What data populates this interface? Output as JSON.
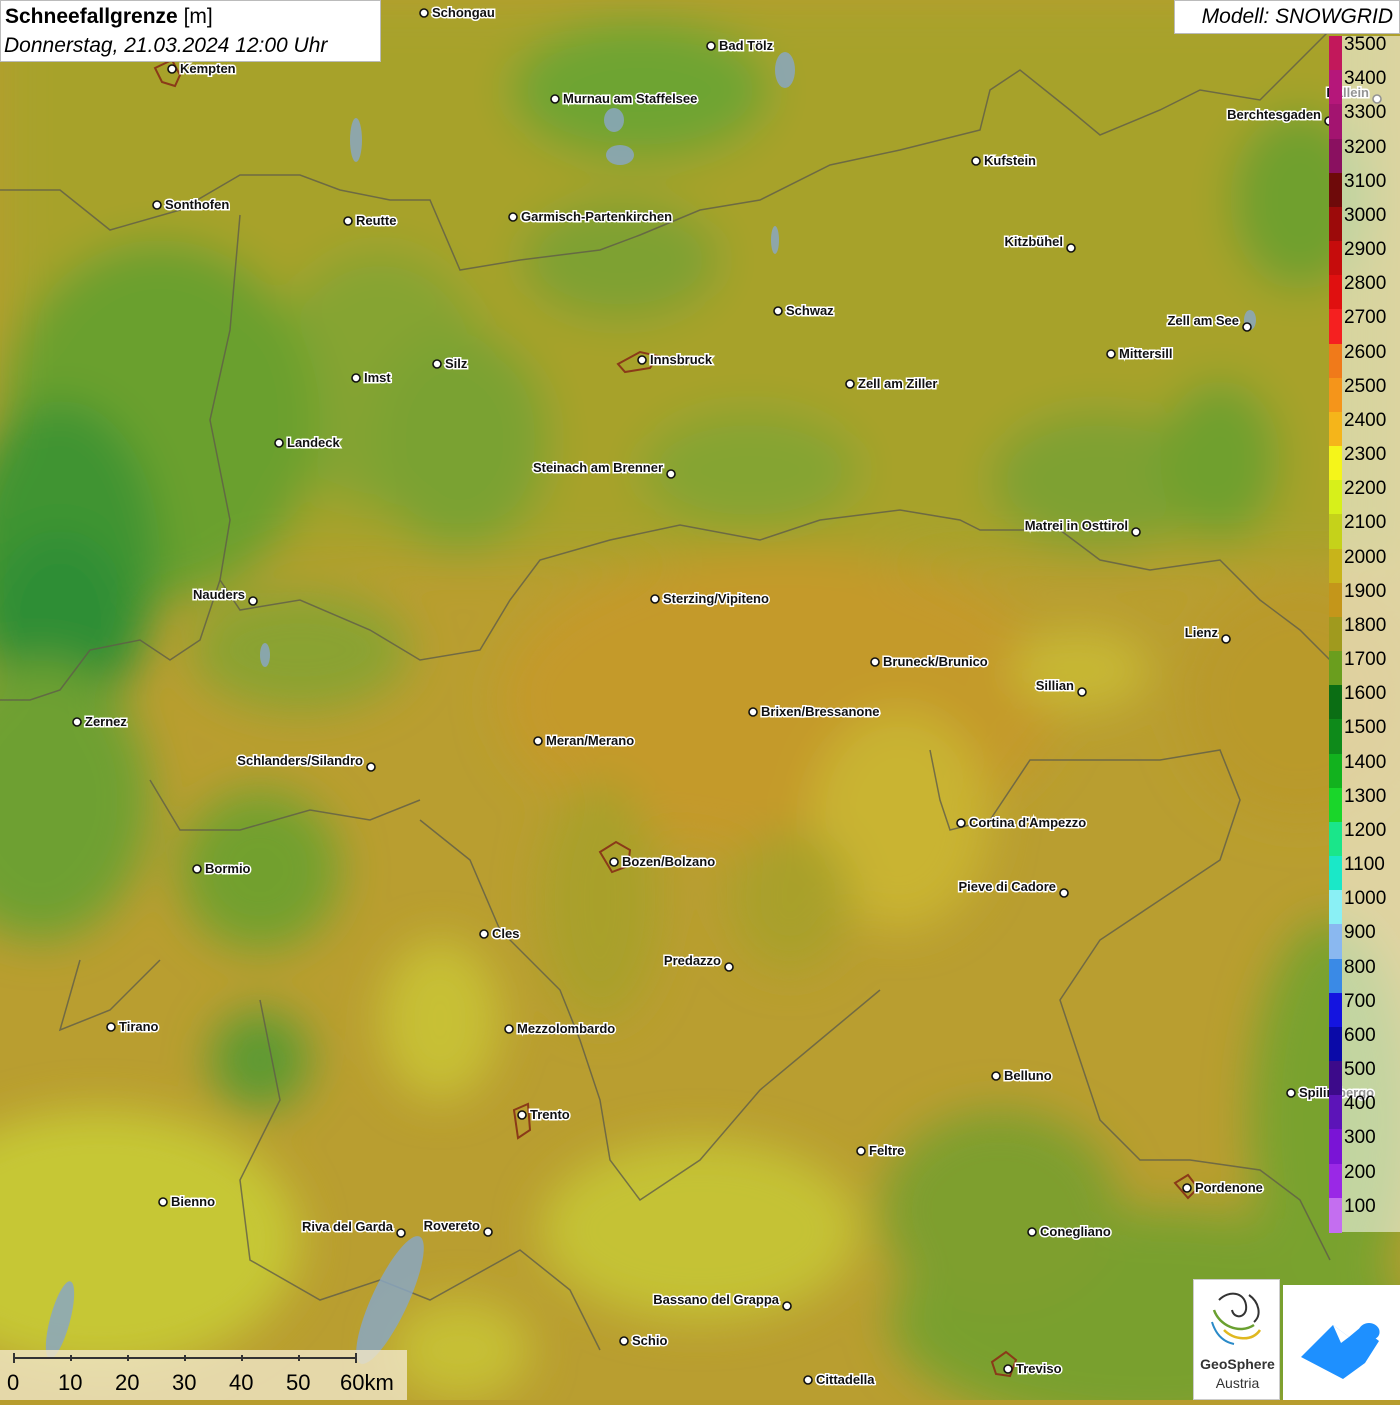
{
  "header": {
    "title": "Schneefallgrenze",
    "unit": "[m]",
    "datetime": "Donnerstag, 21.03.2024 12:00 Uhr"
  },
  "model": {
    "label": "Modell: SNOWGRID"
  },
  "legend": {
    "levels": [
      {
        "label": "3500",
        "color": "#c2185b"
      },
      {
        "label": "3400",
        "color": "#b5177a"
      },
      {
        "label": "3300",
        "color": "#a31470"
      },
      {
        "label": "3200",
        "color": "#8a1060"
      },
      {
        "label": "3100",
        "color": "#6e0a0a"
      },
      {
        "label": "3000",
        "color": "#9c0a0a"
      },
      {
        "label": "2900",
        "color": "#c60c0c"
      },
      {
        "label": "2800",
        "color": "#e01010"
      },
      {
        "label": "2700",
        "color": "#f52020"
      },
      {
        "label": "2600",
        "color": "#f07a1a"
      },
      {
        "label": "2500",
        "color": "#f5951a"
      },
      {
        "label": "2400",
        "color": "#f5b51a"
      },
      {
        "label": "2300",
        "color": "#f5f51a"
      },
      {
        "label": "2200",
        "color": "#d7f01a"
      },
      {
        "label": "2100",
        "color": "#c5d21a"
      },
      {
        "label": "2000",
        "color": "#c8b41a"
      },
      {
        "label": "1900",
        "color": "#c4961a"
      },
      {
        "label": "1800",
        "color": "#a09a1e"
      },
      {
        "label": "1700",
        "color": "#6a9e1e"
      },
      {
        "label": "1600",
        "color": "#0b6e14"
      },
      {
        "label": "1500",
        "color": "#0e8a1a"
      },
      {
        "label": "1400",
        "color": "#12b21e"
      },
      {
        "label": "1300",
        "color": "#1ad62a"
      },
      {
        "label": "1200",
        "color": "#1ae68a"
      },
      {
        "label": "1100",
        "color": "#1ae8c8"
      },
      {
        "label": "1000",
        "color": "#8af0f5"
      },
      {
        "label": "900",
        "color": "#8ab8f0"
      },
      {
        "label": "800",
        "color": "#3a8ae6"
      },
      {
        "label": "700",
        "color": "#1414e0"
      },
      {
        "label": "600",
        "color": "#0a0aa8"
      },
      {
        "label": "500",
        "color": "#3c0a8a"
      },
      {
        "label": "400",
        "color": "#5c14b8"
      },
      {
        "label": "300",
        "color": "#7a14d6"
      },
      {
        "label": "200",
        "color": "#9a28e6"
      },
      {
        "label": "100",
        "color": "#c46ef0"
      }
    ]
  },
  "cities": [
    {
      "name": "Schongau"
    },
    {
      "name": "Bad Tölz"
    },
    {
      "name": "Kempten"
    },
    {
      "name": "Murnau am Staffelsee"
    },
    {
      "name": "Hallein"
    },
    {
      "name": "Berchtesgaden"
    },
    {
      "name": "Kufstein"
    },
    {
      "name": "Sonthofen"
    },
    {
      "name": "Reutte"
    },
    {
      "name": "Garmisch-Partenkirchen"
    },
    {
      "name": "Kitzbühel"
    },
    {
      "name": "Schwaz"
    },
    {
      "name": "Zell am See"
    },
    {
      "name": "Innsbruck"
    },
    {
      "name": "Mittersill"
    },
    {
      "name": "Imst"
    },
    {
      "name": "Silz"
    },
    {
      "name": "Zell am Ziller"
    },
    {
      "name": "Landeck"
    },
    {
      "name": "Steinach am Brenner"
    },
    {
      "name": "Matrei in Osttirol"
    },
    {
      "name": "Nauders"
    },
    {
      "name": "Sterzing/Vipiteno"
    },
    {
      "name": "Lienz"
    },
    {
      "name": "Bruneck/Brunico"
    },
    {
      "name": "Sillian"
    },
    {
      "name": "Brixen/Bressanone"
    },
    {
      "name": "Zernez"
    },
    {
      "name": "Meran/Merano"
    },
    {
      "name": "Schlanders/Silandro"
    },
    {
      "name": "Cortina d'Ampezzo"
    },
    {
      "name": "Bormio"
    },
    {
      "name": "Bozen/Bolzano"
    },
    {
      "name": "Pieve di Cadore"
    },
    {
      "name": "Cles"
    },
    {
      "name": "Predazzo"
    },
    {
      "name": "Tirano"
    },
    {
      "name": "Mezzolombardo"
    },
    {
      "name": "Belluno"
    },
    {
      "name": "Spilimbergo"
    },
    {
      "name": "Trento"
    },
    {
      "name": "Feltre"
    },
    {
      "name": "Pordenone"
    },
    {
      "name": "Bienno"
    },
    {
      "name": "Riva del Garda"
    },
    {
      "name": "Rovereto"
    },
    {
      "name": "Conegliano"
    },
    {
      "name": "Bassano del Grappa"
    },
    {
      "name": "Schio"
    },
    {
      "name": "Treviso"
    },
    {
      "name": "Cittadella"
    }
  ],
  "scale": {
    "labels": [
      "0",
      "10",
      "20",
      "30",
      "40",
      "50",
      "60km"
    ]
  },
  "logos": {
    "geosphere_line1": "GeoSphere",
    "geosphere_line2": "Austria"
  }
}
